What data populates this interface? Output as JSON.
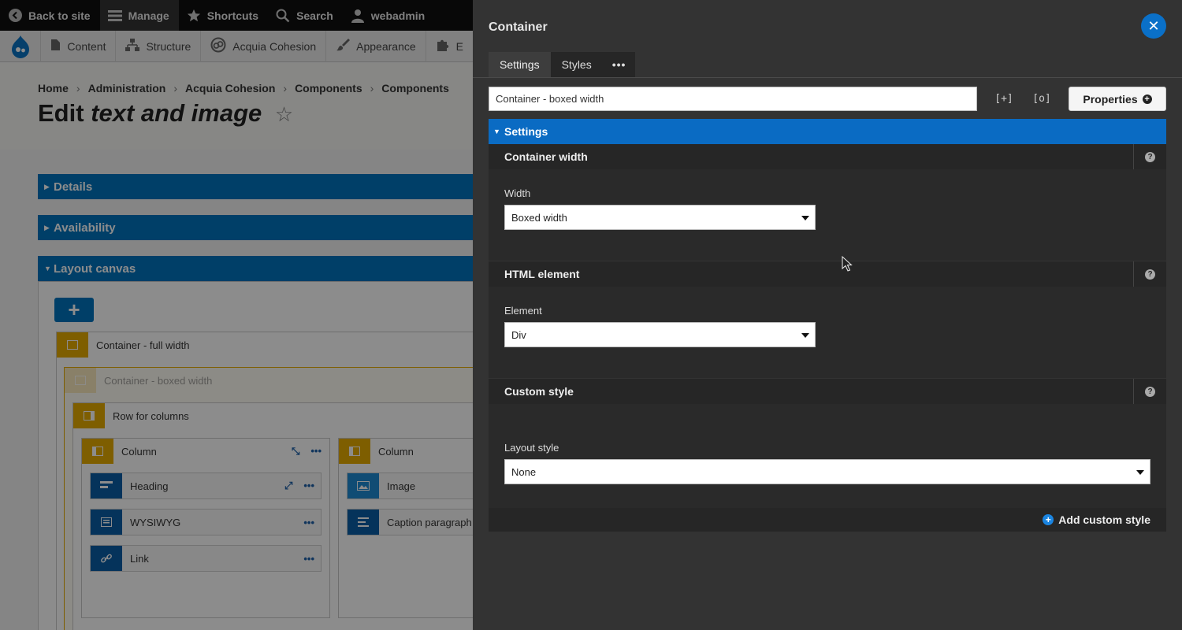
{
  "toolbar": {
    "back_to_site": "Back to site",
    "manage": "Manage",
    "shortcuts": "Shortcuts",
    "search": "Search",
    "user": "webadmin"
  },
  "tray": {
    "content": "Content",
    "structure": "Structure",
    "cohesion": "Acquia Cohesion",
    "appearance": "Appearance",
    "extend": "E"
  },
  "breadcrumb": [
    "Home",
    "Administration",
    "Acquia Cohesion",
    "Components",
    "Components"
  ],
  "page": {
    "title_prefix": "Edit",
    "title_em": "text and image",
    "star": "☆"
  },
  "accordions": {
    "details": "Details",
    "availability": "Availability",
    "layout_canvas": "Layout canvas"
  },
  "canvas": {
    "add": "+",
    "container_full": "Container - full width",
    "container_boxed": "Container - boxed width",
    "row": "Row for columns",
    "column1": "Column",
    "column2": "Column",
    "heading": "Heading",
    "wysiwyg": "WYSIWYG",
    "link": "Link",
    "image": "Image",
    "caption": "Caption paragraph",
    "more": "•••"
  },
  "panel": {
    "title": "Container",
    "close": "✕",
    "tabs": {
      "settings": "Settings",
      "styles": "Styles",
      "more": "•••"
    },
    "name_value": "Container - boxed width",
    "icon_expand": "[+]",
    "icon_focus": "[o]",
    "properties": "Properties",
    "settings_section": "Settings",
    "groups": {
      "container_width": {
        "title": "Container width",
        "label": "Width",
        "value": "Boxed width"
      },
      "html_element": {
        "title": "HTML element",
        "label": "Element",
        "value": "Div"
      },
      "custom_style": {
        "title": "Custom style",
        "label": "Layout style",
        "value": "None"
      }
    },
    "help": "?",
    "add_custom_style": "Add custom style"
  },
  "colors": {
    "drupal_blue": "#0074bd",
    "panel_bg": "#333333",
    "accent_yellow": "#e6ac00"
  }
}
